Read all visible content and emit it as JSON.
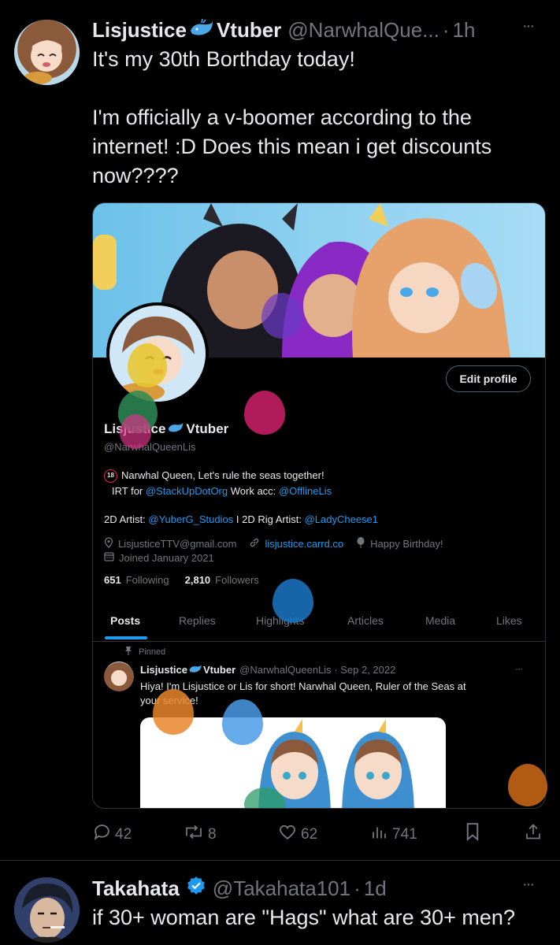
{
  "tweet": {
    "display_name": "Lisjustice",
    "name_suffix": "Vtuber",
    "handle": "@NarwhalQue...",
    "dot": "·",
    "time": "1h",
    "more": "···",
    "line1": "It's my 30th Borthday today!",
    "line2": "I'm officially a v-boomer according to the",
    "line3": "internet! :D Does this mean i get discounts",
    "line4": "now????",
    "actions": {
      "reply": "42",
      "retweet": "8",
      "like": "62",
      "views": "741"
    }
  },
  "profile_card": {
    "edit_button": "Edit profile",
    "name": "Lisjustice",
    "name_suffix": "Vtuber",
    "handle": "@NarwhalQueenLis",
    "age_badge": "18",
    "bio_line1": "Narwhal Queen, Let's rule the seas together!",
    "bio_irt": "IRT for",
    "bio_irt_link": "@StackUpDotOrg",
    "bio_work": "Work acc:",
    "bio_work_link": "@OfflineLis",
    "artist_label": "2D Artist:",
    "artist_link": "@YuberG_Studios",
    "rig_label": "I 2D Rig Artist:",
    "rig_link": "@LadyCheese1",
    "email": "LisjusticeTTV@gmail.com",
    "website": "lisjustice.carrd.co",
    "birthday": "Happy Birthday!",
    "joined": "Joined January 2021",
    "following_count": "651",
    "following_label": "Following",
    "followers_count": "2,810",
    "followers_label": "Followers",
    "tabs": [
      "Posts",
      "Replies",
      "Highlights",
      "Articles",
      "Media",
      "Likes"
    ],
    "pinned_label": "Pinned",
    "pinned_name": "Lisjustice",
    "pinned_suffix": "Vtuber",
    "pinned_meta": "@NarwhalQueenLis · Sep 2, 2022",
    "pinned_more": "···",
    "pinned_text1": "Hiya! I'm Lisjustice or Lis for short! Narwhal Queen, Ruler of the Seas at",
    "pinned_text2": "your service!"
  },
  "reply": {
    "display_name": "Takahata",
    "handle": "@Takahata101",
    "dot": "·",
    "time": "1d",
    "more": "···",
    "text": "if 30+ woman are \"Hags\" what are 30+ men?"
  },
  "colors": {
    "background": "#000000",
    "text": "#e7e9ea",
    "muted": "#71767b",
    "link": "#1d9bf0",
    "verified": "#1d9bf0"
  }
}
